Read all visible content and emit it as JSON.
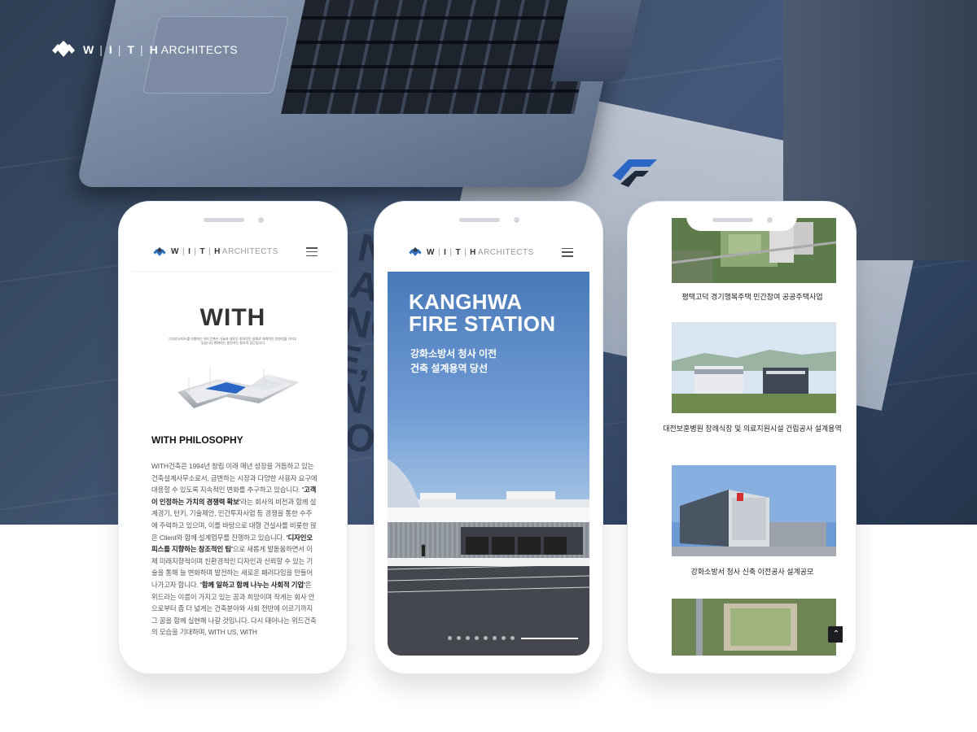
{
  "brand": {
    "w": "W",
    "i": "I",
    "t": "T",
    "h": "H",
    "architects": "ARCHITECTS"
  },
  "background": {
    "letters": "NI\nAR\nNG\nE,\nIN\nYO"
  },
  "phone1": {
    "hero_word": "WITH",
    "hero_sub": "디자인오피스를 지향하는 위드건축은 기술과 새로운 창의적인 설계로 체계적인 방향성을 가지고 있습니다 변화하는 발전하는 창조적 집단입니다",
    "philosophy_title": "WITH PHILOSOPHY",
    "philosophy_parts": [
      {
        "t": "WITH건축은 1994년 창립 이래 매년 성장을 거듭하고 있는 건축설계사무소로서, 급변하는 시장과 다양한 사용자 요구에 대응할 수 있도록 지속적인 변화를 추구하고 있습니다. ",
        "b": false
      },
      {
        "t": "'고객이 인정하는 가치의 경쟁력 확보'",
        "b": true
      },
      {
        "t": "라는 회사의 비전과 함께 설계경기, 턴키, 기술제안, 민간투자사업 등 경쟁을 통한 수주에 주력하고 있으며, 이를 바탕으로 대형 건설사를 비롯한 많은 Client와 함께 설계업무를 진행하고 있습니다. ",
        "b": false
      },
      {
        "t": "'디자인오피스를 지향하는 창조적인 팀'",
        "b": true
      },
      {
        "t": "으로 새롭게 발돋움하면서 이제 미래지향적이며 친환경적인 디자인과 신뢰할 수 있는 기술을 통해 늘 변화하며 발전하는 새로운 패러다임을 만들어 나가고자 합니다. ",
        "b": false
      },
      {
        "t": "'함께 일하고 함께 나누는 사회적 기업'",
        "b": true
      },
      {
        "t": "은 위드라는 이름이 가지고 있는 꿈과 희망이며 작게는 회사 안으로부터 좀 더 넓게는 건축분야와 사회 전반에 이르기까지 그 꿈을 함께 실현해 나갈 것입니다. 다시 태어나는 위드건축의 모습을 기대하며, WITH US, WITH",
        "b": false
      }
    ]
  },
  "phone2": {
    "title_line1": "KANGHWA",
    "title_line2": "FIRE STATION",
    "sub_line1": "강화소방서 청사 이전",
    "sub_line2": "건축 설계용역 당선",
    "slide_count": 8
  },
  "phone3": {
    "projects": [
      {
        "caption": "평택고덕 경기행복주택 민간참여 공공주택사업"
      },
      {
        "caption": "대전보훈병원 장례식장 및 의료지원시설 건립공사 설계용역"
      },
      {
        "caption": "강화소방서 청사 신축 이전공사 설계공모"
      }
    ],
    "to_top": "⌃"
  },
  "colors": {
    "accent": "#2f6fc0",
    "dark": "#1b1d22",
    "bg": "#3b4e68"
  }
}
